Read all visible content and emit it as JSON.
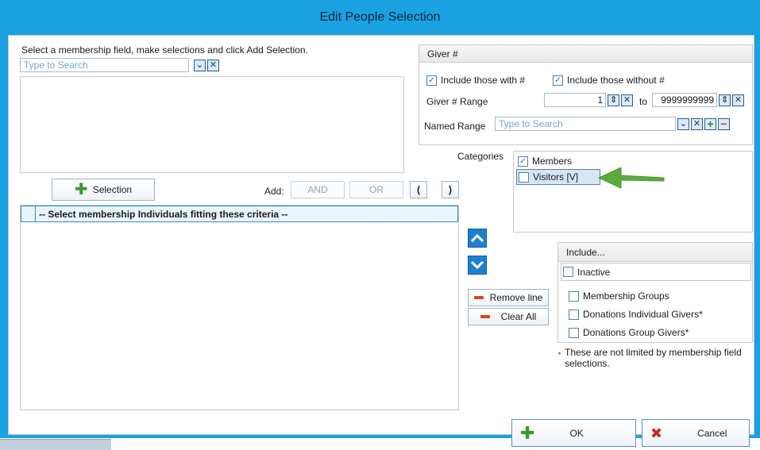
{
  "window": {
    "title": "Edit People Selection"
  },
  "left_panel": {
    "instruction": "Select a membership field, make selections and click Add Selection.",
    "search_placeholder": "Type to Search",
    "selection_button_label": "Selection",
    "add_label": "Add:",
    "and_label": "AND",
    "or_label": "OR",
    "open_paren_label": "(",
    "close_paren_label": ")",
    "criteria_header": "-- Select membership Individuals fitting these criteria --"
  },
  "giver": {
    "title": "Giver #",
    "include_with_label": "Include those with #",
    "include_with_checked": true,
    "include_without_label": "Include those without #",
    "include_without_checked": true,
    "range_label": "Giver # Range",
    "range_from": "1",
    "range_to_label": "to",
    "range_to": "9999999999",
    "named_range_label": "Named Range",
    "named_range_placeholder": "Type to Search"
  },
  "categories": {
    "label": "Categories",
    "items": [
      {
        "label": "Members",
        "checked": true
      },
      {
        "label": "Visitors [V]",
        "checked": false
      }
    ]
  },
  "line_controls": {
    "remove_line_label": "Remove line",
    "clear_all_label": "Clear All"
  },
  "include": {
    "title": "Include...",
    "inactive_label": "Inactive",
    "items": [
      {
        "label": "Membership Groups",
        "checked": false
      },
      {
        "label": "Donations Individual Givers*",
        "checked": false
      },
      {
        "label": "Donations Group Givers*",
        "checked": false
      }
    ],
    "footnote_star": "*",
    "footnote": "These are not limited by membership field selections."
  },
  "footer": {
    "ok_label": "OK",
    "cancel_label": "Cancel"
  },
  "colors": {
    "title_bar": "#1aa1e1",
    "annotation_arrow": "#5aac3c",
    "plus_icon": "#3a9a2e",
    "minus_icon": "#d9431c"
  }
}
